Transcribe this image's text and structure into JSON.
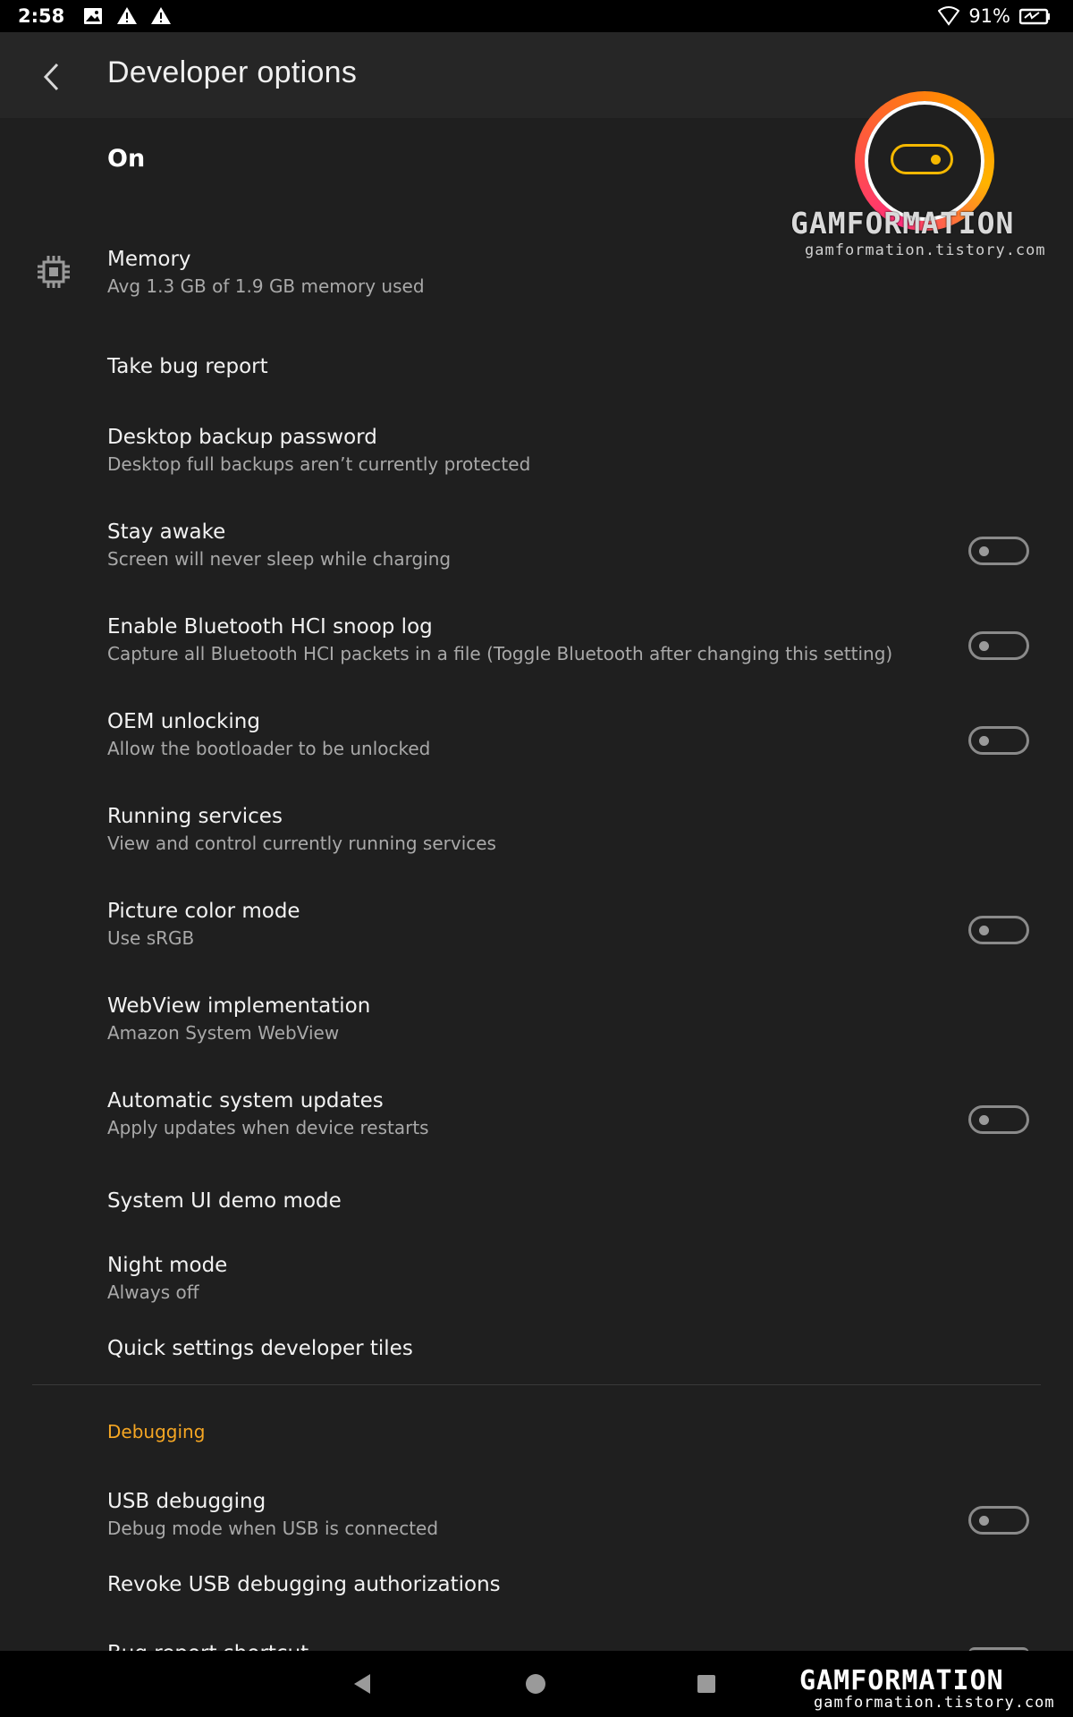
{
  "status_bar": {
    "time": "2:58",
    "left_icons": [
      "image-icon",
      "warning-icon",
      "warning-icon"
    ],
    "battery": "91%",
    "right_icons": [
      "wifi-icon",
      "battery-charging-icon"
    ]
  },
  "app_bar": {
    "title": "Developer options",
    "back_icon": "chevron-left-icon"
  },
  "master_switch": {
    "label": "On",
    "state": true
  },
  "settings": [
    {
      "id": "memory",
      "title": "Memory",
      "subtitle": "Avg 1.3 GB of 1.9 GB memory used",
      "icon": "memory-chip-icon",
      "toggle": null
    },
    {
      "id": "bug-report",
      "title": "Take bug report",
      "subtitle": "",
      "toggle": null
    },
    {
      "id": "backup-password",
      "title": "Desktop backup password",
      "subtitle": "Desktop full backups aren’t currently protected",
      "toggle": null
    },
    {
      "id": "stay-awake",
      "title": "Stay awake",
      "subtitle": "Screen will never sleep while charging",
      "toggle": false
    },
    {
      "id": "bt-snoop",
      "title": "Enable Bluetooth HCI snoop log",
      "subtitle": "Capture all Bluetooth HCI packets in a file (Toggle Bluetooth after changing this setting)",
      "toggle": false
    },
    {
      "id": "oem-unlocking",
      "title": "OEM unlocking",
      "subtitle": "Allow the bootloader to be unlocked",
      "toggle": false
    },
    {
      "id": "running-services",
      "title": "Running services",
      "subtitle": "View and control currently running services",
      "toggle": null
    },
    {
      "id": "picture-color-mode",
      "title": "Picture color mode",
      "subtitle": "Use sRGB",
      "toggle": false
    },
    {
      "id": "webview",
      "title": "WebView implementation",
      "subtitle": "Amazon System WebView",
      "toggle": null
    },
    {
      "id": "auto-updates",
      "title": "Automatic system updates",
      "subtitle": "Apply updates when device restarts",
      "toggle": false
    },
    {
      "id": "demo-mode",
      "title": "System UI demo mode",
      "subtitle": "",
      "toggle": null
    },
    {
      "id": "night-mode",
      "title": "Night mode",
      "subtitle": "Always off",
      "toggle": null
    },
    {
      "id": "qs-tiles",
      "title": "Quick settings developer tiles",
      "subtitle": "",
      "toggle": null
    }
  ],
  "debugging": {
    "header": "Debugging",
    "items": [
      {
        "id": "usb-debugging",
        "title": "USB debugging",
        "subtitle": "Debug mode when USB is connected",
        "toggle": false
      },
      {
        "id": "revoke-usb",
        "title": "Revoke USB debugging authorizations",
        "subtitle": "",
        "toggle": null
      }
    ],
    "partial_item": "Bug report shortcut"
  },
  "watermark": {
    "brand": "GAMFORMATION",
    "url": "gamformation.tistory.com"
  },
  "nav_bar": {
    "icons": [
      "nav-back-icon",
      "nav-home-icon",
      "nav-recents-icon"
    ]
  },
  "colors": {
    "background": "#1f1f1f",
    "app_bar": "#262626",
    "accent": "#f5a623",
    "subtitle": "#a9a9a9"
  }
}
